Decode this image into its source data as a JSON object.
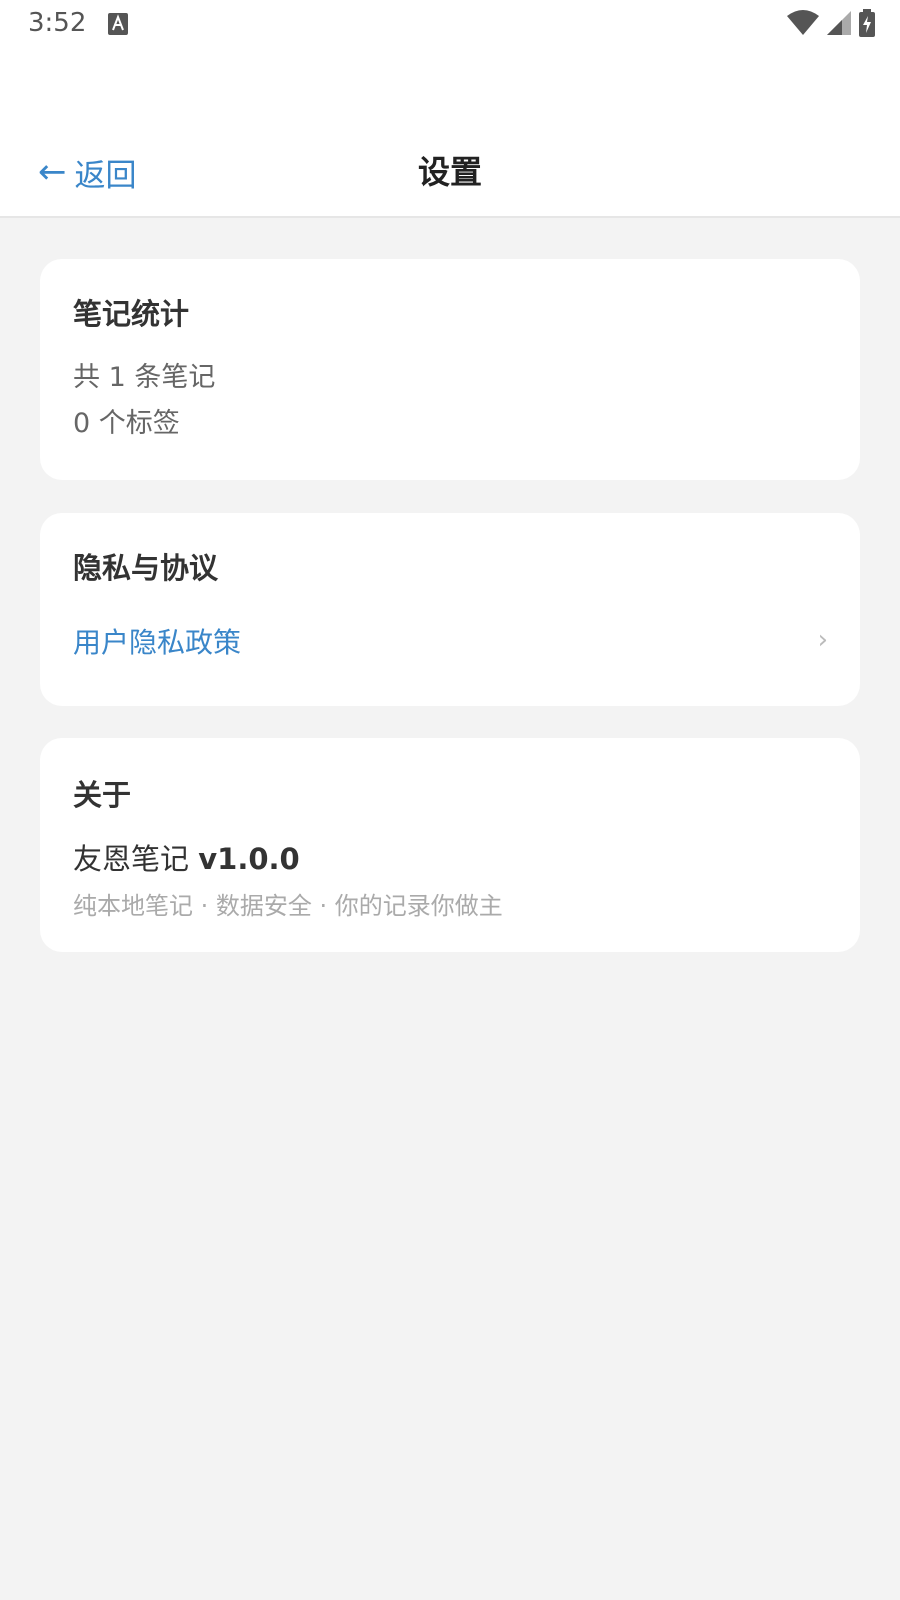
{
  "status_bar": {
    "time": "3:52",
    "notification_icon": "font-a-icon",
    "wifi_icon": "wifi-icon",
    "signal_icon": "cell-signal-icon",
    "battery_icon": "battery-charging-icon"
  },
  "nav": {
    "back_arrow": "←",
    "back_label": "返回",
    "title": "设置"
  },
  "stats": {
    "title": "笔记统计",
    "notes_count": "共 1 条笔记",
    "tags_count": "0 个标签"
  },
  "privacy": {
    "title": "隐私与协议",
    "policy_label": "用户隐私政策",
    "chevron": "›"
  },
  "about": {
    "title": "关于",
    "app_name": "友恩笔记",
    "app_version": "v1.0.0",
    "description": "纯本地笔记 · 数据安全 · 你的记录你做主"
  },
  "colors": {
    "accent": "#3a86c9",
    "background": "#f3f3f3",
    "card": "#ffffff"
  }
}
